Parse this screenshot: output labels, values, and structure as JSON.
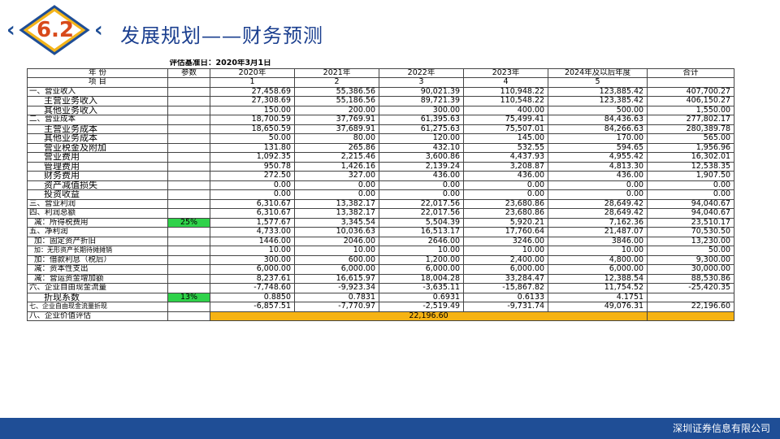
{
  "header": {
    "badge": "6.2",
    "title": "发展规划——财务预测"
  },
  "table": {
    "date_label": "评估基准日：2020年3月1日",
    "header_row1": [
      "年    份",
      "参数",
      "2020年",
      "2021年",
      "2022年",
      "2023年",
      "2024年及以后年度",
      "合计"
    ],
    "header_row2": [
      "项      目",
      "",
      "1",
      "2",
      "3",
      "4",
      "5",
      ""
    ],
    "rows": [
      {
        "label": "一、营业收入",
        "param": "",
        "values": [
          "27,458.69",
          "55,386.56",
          "90,021.39",
          "110,948.22",
          "123,885.42",
          "407,700.27"
        ]
      },
      {
        "label": "主营业务收入",
        "param": "",
        "values": [
          "27,308.69",
          "55,186.56",
          "89,721.39",
          "110,548.22",
          "123,385.42",
          "406,150.27"
        ]
      },
      {
        "label": "其他业务收入",
        "param": "",
        "values": [
          "150.00",
          "200.00",
          "300.00",
          "400.00",
          "500.00",
          "1,550.00"
        ]
      },
      {
        "label": "二、营业成本",
        "param": "",
        "values": [
          "18,700.59",
          "37,769.91",
          "61,395.63",
          "75,499.41",
          "84,436.63",
          "277,802.17"
        ]
      },
      {
        "label": "主营业务成本",
        "param": "",
        "values": [
          "18,650.59",
          "37,689.91",
          "61,275.63",
          "75,507.01",
          "84,266.63",
          "280,389.78"
        ]
      },
      {
        "label": "其他业务成本",
        "param": "",
        "values": [
          "50.00",
          "80.00",
          "120.00",
          "145.00",
          "170.00",
          "565.00"
        ]
      },
      {
        "label": "营业税金及附加",
        "param": "",
        "values": [
          "131.80",
          "265.86",
          "432.10",
          "532.55",
          "594.65",
          "1,956.96"
        ]
      },
      {
        "label": "营业费用",
        "param": "",
        "values": [
          "1,092.35",
          "2,215.46",
          "3,600.86",
          "4,437.93",
          "4,955.42",
          "16,302.01"
        ]
      },
      {
        "label": "管理费用",
        "param": "",
        "values": [
          "950.78",
          "1,426.16",
          "2,139.24",
          "3,208.87",
          "4,813.30",
          "12,538.35"
        ]
      },
      {
        "label": "财务费用",
        "param": "",
        "values": [
          "272.50",
          "327.00",
          "436.00",
          "436.00",
          "436.00",
          "1,907.50"
        ]
      },
      {
        "label": "资产减值损失",
        "param": "",
        "values": [
          "0.00",
          "0.00",
          "0.00",
          "0.00",
          "0.00",
          "0.00"
        ]
      },
      {
        "label": "投资收益",
        "param": "",
        "values": [
          "0.00",
          "0.00",
          "0.00",
          "0.00",
          "0.00",
          "0.00"
        ]
      },
      {
        "label": "三、营业利润",
        "param": "",
        "values": [
          "6,310.67",
          "13,382.17",
          "22,017.56",
          "23,680.86",
          "28,649.42",
          "94,040.67"
        ]
      },
      {
        "label": "四、利润总额",
        "param": "",
        "values": [
          "6,310.67",
          "13,382.17",
          "22,017.56",
          "23,680.86",
          "28,649.42",
          "94,040.67"
        ]
      },
      {
        "label": "减：所得税费用",
        "param": "25%",
        "values": [
          "1,577.67",
          "3,345.54",
          "5,504.39",
          "5,920.21",
          "7,162.36",
          "23,510.17"
        ]
      },
      {
        "label": "五、净利润",
        "param": "",
        "values": [
          "4,733.00",
          "10,036.63",
          "16,513.17",
          "17,760.64",
          "21,487.07",
          "70,530.50"
        ]
      },
      {
        "label": "加：固定资产折旧",
        "param": "",
        "values": [
          "1446.00",
          "2046.00",
          "2646.00",
          "3246.00",
          "3846.00",
          "13,230.00"
        ]
      },
      {
        "label": "加：无形资产长期待摊摊销",
        "param": "",
        "values": [
          "10.00",
          "10.00",
          "10.00",
          "10.00",
          "10.00",
          "50.00"
        ]
      },
      {
        "label": "加：借款利息（税后）",
        "param": "",
        "values": [
          "300.00",
          "600.00",
          "1,200.00",
          "2,400.00",
          "4,800.00",
          "9,300.00"
        ]
      },
      {
        "label": "减：资本性支出",
        "param": "",
        "values": [
          "6,000.00",
          "6,000.00",
          "6,000.00",
          "6,000.00",
          "6,000.00",
          "30,000.00"
        ]
      },
      {
        "label": "减：营运资金增加额",
        "param": "",
        "values": [
          "8,237.61",
          "16,615.97",
          "18,004.28",
          "33,284.47",
          "12,388.54",
          "88,530.86"
        ]
      },
      {
        "label": "六、企业自由现金流量",
        "param": "",
        "values": [
          "-7,748.60",
          "-9,923.34",
          "-3,635.11",
          "-15,867.82",
          "11,754.52",
          "-25,420.35"
        ]
      },
      {
        "label": "折现系数",
        "param": "13%",
        "values": [
          "0.8850",
          "0.7831",
          "0.6931",
          "0.6133",
          "4.1751",
          ""
        ]
      },
      {
        "label": "七、企业自由现金流量折现",
        "param": "",
        "values": [
          "-6,857.51",
          "-7,770.97",
          "-2,519.49",
          "-9,731.74",
          "49,076.31",
          "22,196.60"
        ]
      }
    ],
    "final_row": {
      "label": "八、企业价值评估",
      "value": "22,196.60"
    }
  },
  "footer": {
    "company": "深圳证券信息有限公司"
  },
  "colors": {
    "brand_blue": "#1f4e96",
    "badge_orange": "#d84a1b",
    "param_green": "#2fd24a",
    "total_orange": "#f6b313"
  }
}
